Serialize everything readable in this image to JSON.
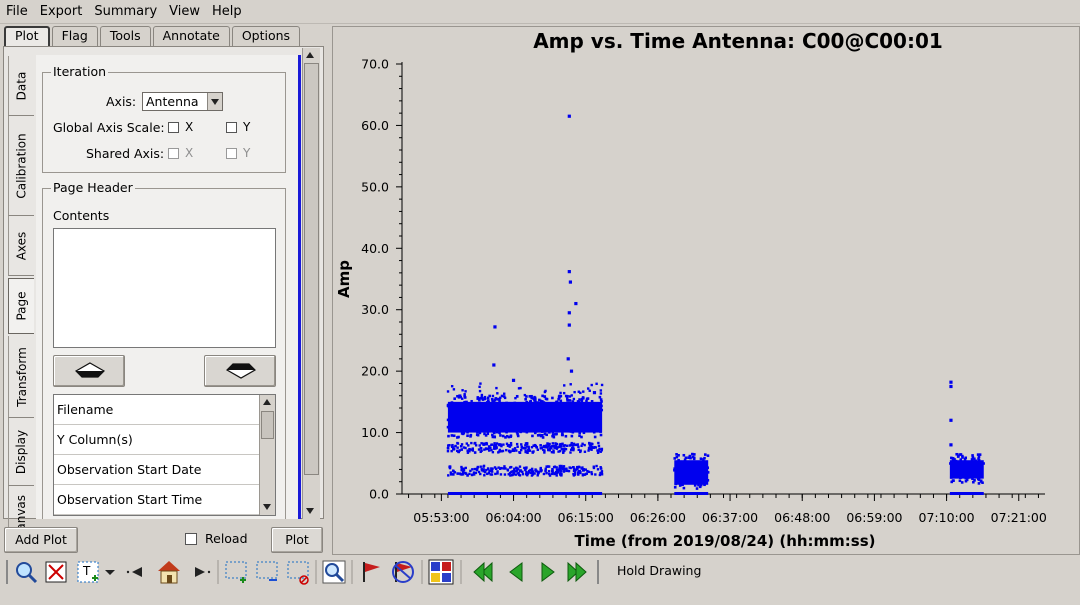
{
  "menu": [
    "File",
    "Export",
    "Summary",
    "View",
    "Help"
  ],
  "left_tabs": [
    "Plot",
    "Flag",
    "Tools",
    "Annotate",
    "Options"
  ],
  "side_tabs": [
    "Data",
    "Calibration",
    "Axes",
    "Page",
    "Transform",
    "Display",
    "Canvas"
  ],
  "iteration": {
    "group_title": "Iteration",
    "axis_label": "Axis:",
    "axis_value": "Antenna",
    "global_scale_label": "Global Axis Scale:",
    "shared_label": "Shared Axis:",
    "x_label": "X",
    "y_label": "Y"
  },
  "page_header": {
    "group_title": "Page Header",
    "contents_label": "Contents",
    "list_items": [
      "Filename",
      "Y Column(s)",
      "Observation Start Date",
      "Observation Start Time"
    ]
  },
  "bottom": {
    "add_plot": "Add Plot",
    "reload": "Reload",
    "plot": "Plot"
  },
  "toolbar": {
    "hold_drawing": "Hold Drawing"
  },
  "chart_data": {
    "type": "scatter",
    "title": "Amp vs. Time Antenna: C00@C00:01",
    "xlabel": "Time (from 2019/08/24) (hh:mm:ss)",
    "ylabel": "Amp",
    "x_ticks": [
      "05:53:00",
      "06:04:00",
      "06:15:00",
      "06:26:00",
      "06:37:00",
      "06:48:00",
      "06:59:00",
      "07:10:00",
      "07:21:00"
    ],
    "y_ticks": [
      "0.0",
      "10.0",
      "20.0",
      "30.0",
      "40.0",
      "50.0",
      "60.0",
      "70.0"
    ],
    "ylim": [
      0,
      70
    ],
    "marker_color": "#0000ee",
    "scans": [
      {
        "start": "05:54:00",
        "end": "06:17:30",
        "amp_band": [
          10,
          15
        ],
        "amp_baseline": 0
      },
      {
        "start": "06:28:30",
        "end": "06:33:40",
        "amp_band": [
          1.5,
          5.5
        ],
        "amp_baseline": 0
      },
      {
        "start": "07:10:30",
        "end": "07:15:40",
        "amp_band": [
          2.5,
          5.5
        ],
        "amp_baseline": 0
      }
    ],
    "outliers": [
      {
        "x": "06:12:30",
        "y": 61.5
      },
      {
        "x": "06:12:30",
        "y": 36.2
      },
      {
        "x": "06:12:40",
        "y": 34.5
      },
      {
        "x": "06:13:30",
        "y": 31.0
      },
      {
        "x": "06:12:30",
        "y": 29.5
      },
      {
        "x": "06:12:30",
        "y": 27.5
      },
      {
        "x": "06:01:10",
        "y": 27.2
      },
      {
        "x": "06:12:20",
        "y": 22.0
      },
      {
        "x": "06:12:50",
        "y": 20.0
      },
      {
        "x": "06:01:00",
        "y": 21.0
      },
      {
        "x": "06:04:00",
        "y": 18.5
      },
      {
        "x": "06:16:20",
        "y": 16.5
      },
      {
        "x": "07:10:40",
        "y": 18.2
      },
      {
        "x": "07:10:40",
        "y": 17.5
      },
      {
        "x": "07:10:40",
        "y": 12.0
      },
      {
        "x": "07:10:40",
        "y": 8.0
      }
    ]
  }
}
